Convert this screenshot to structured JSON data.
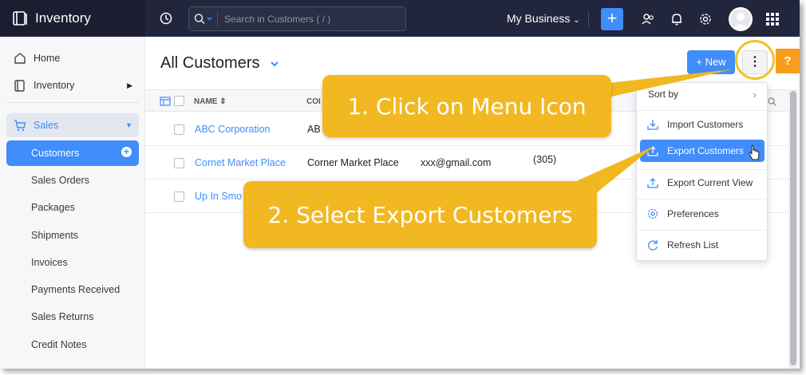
{
  "app": {
    "name": "Inventory"
  },
  "search": {
    "placeholder": "Search in Customers ( / )"
  },
  "org": {
    "name": "My Business"
  },
  "sidebar": {
    "items": [
      {
        "label": "Home"
      },
      {
        "label": "Inventory"
      },
      {
        "label": "Sales"
      },
      {
        "label": "Customers"
      },
      {
        "label": "Sales Orders"
      },
      {
        "label": "Packages"
      },
      {
        "label": "Shipments"
      },
      {
        "label": "Invoices"
      },
      {
        "label": "Payments Received"
      },
      {
        "label": "Sales Returns"
      },
      {
        "label": "Credit Notes"
      }
    ]
  },
  "page": {
    "title": "All Customers",
    "new_label": "+ New",
    "menu_label": "⋮",
    "help_label": "?"
  },
  "table": {
    "columns": [
      "NAME",
      "COI"
    ],
    "rows": [
      {
        "name": "ABC Corporation",
        "company": "AB",
        "email": "",
        "phone": ""
      },
      {
        "name": "Cornet Market Place",
        "company": "Corner Market Place",
        "email": "xxx@gmail.com",
        "phone": "(305)"
      },
      {
        "name": "Up In Smo",
        "company": "",
        "email": "",
        "phone": ""
      }
    ]
  },
  "menu": {
    "sort_label": "Sort by",
    "items": [
      {
        "label": "Import Customers",
        "icon": "import-icon"
      },
      {
        "label": "Export Customers",
        "icon": "export-icon"
      },
      {
        "label": "Export Current View",
        "icon": "export-view-icon"
      },
      {
        "label": "Preferences",
        "icon": "gear-icon"
      },
      {
        "label": "Refresh List",
        "icon": "refresh-icon"
      }
    ]
  },
  "callouts": {
    "step1": "1. Click on Menu Icon",
    "step2": "2. Select Export Customers"
  },
  "colors": {
    "accent": "#408dfb",
    "callout": "#f2b822",
    "topbar": "#21263c"
  }
}
